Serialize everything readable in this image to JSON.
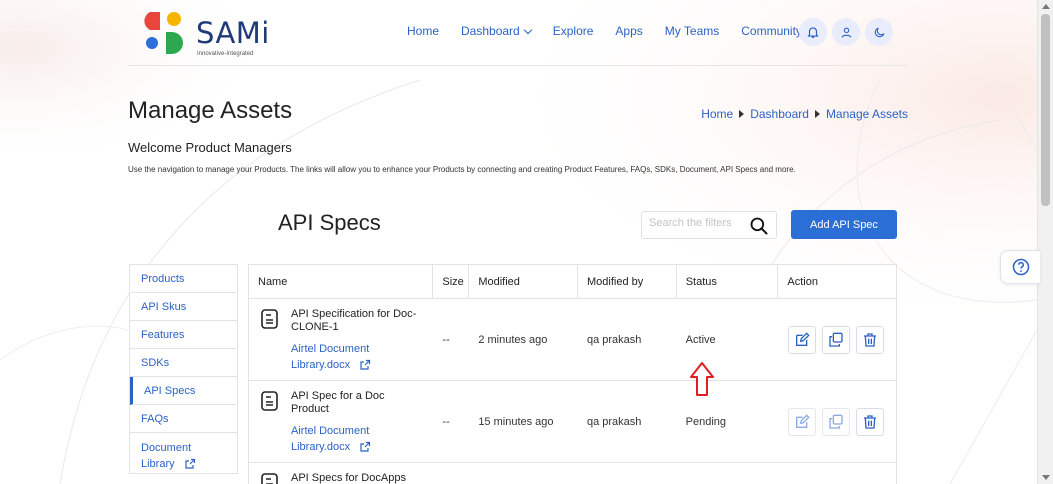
{
  "brand": {
    "name": "SAMi",
    "tagline": "Innovative-Integrated"
  },
  "nav": {
    "items": [
      {
        "label": "Home"
      },
      {
        "label": "Dashboard"
      },
      {
        "label": "Explore"
      },
      {
        "label": "Apps"
      },
      {
        "label": "My Teams"
      },
      {
        "label": "Community"
      }
    ],
    "icons": [
      "bell-icon",
      "user-icon",
      "moon-icon"
    ]
  },
  "page": {
    "title": "Manage Assets",
    "breadcrumb": [
      "Home",
      "Dashboard",
      "Manage Assets"
    ],
    "welcome": "Welcome Product Managers",
    "description": "Use the navigation to manage your Products. The links will allow you to enhance your Products by connecting and creating Product Features, FAQs, SDKs, Document, API Specs and more."
  },
  "section": {
    "title": "API Specs",
    "search_placeholder": "Search the filters",
    "add_button": "Add API Spec"
  },
  "sidenav": {
    "items": [
      "Products",
      "API Skus",
      "Features",
      "SDKs",
      "API Specs",
      "FAQs",
      "Document Library"
    ],
    "active": "API Specs"
  },
  "table": {
    "columns": [
      "Name",
      "Size",
      "Modified",
      "Modified by",
      "Status",
      "Action"
    ],
    "rows": [
      {
        "name": "API Specification for Doc-CLONE-1",
        "file": "Airtel Document Library.docx",
        "size": "--",
        "modified": "2 minutes ago",
        "modified_by": "qa prakash",
        "status": "Active"
      },
      {
        "name": "API Spec for a Doc Product",
        "file": "Airtel Document Library.docx",
        "size": "--",
        "modified": "15 minutes ago",
        "modified_by": "qa prakash",
        "status": "Pending"
      },
      {
        "name": "API Specs for DocApps",
        "file": "",
        "size": "",
        "modified": "",
        "modified_by": "",
        "status": ""
      }
    ]
  },
  "colors": {
    "accent": "#2b62c6",
    "button": "#2b6fd6",
    "annotation": "#e02020"
  }
}
